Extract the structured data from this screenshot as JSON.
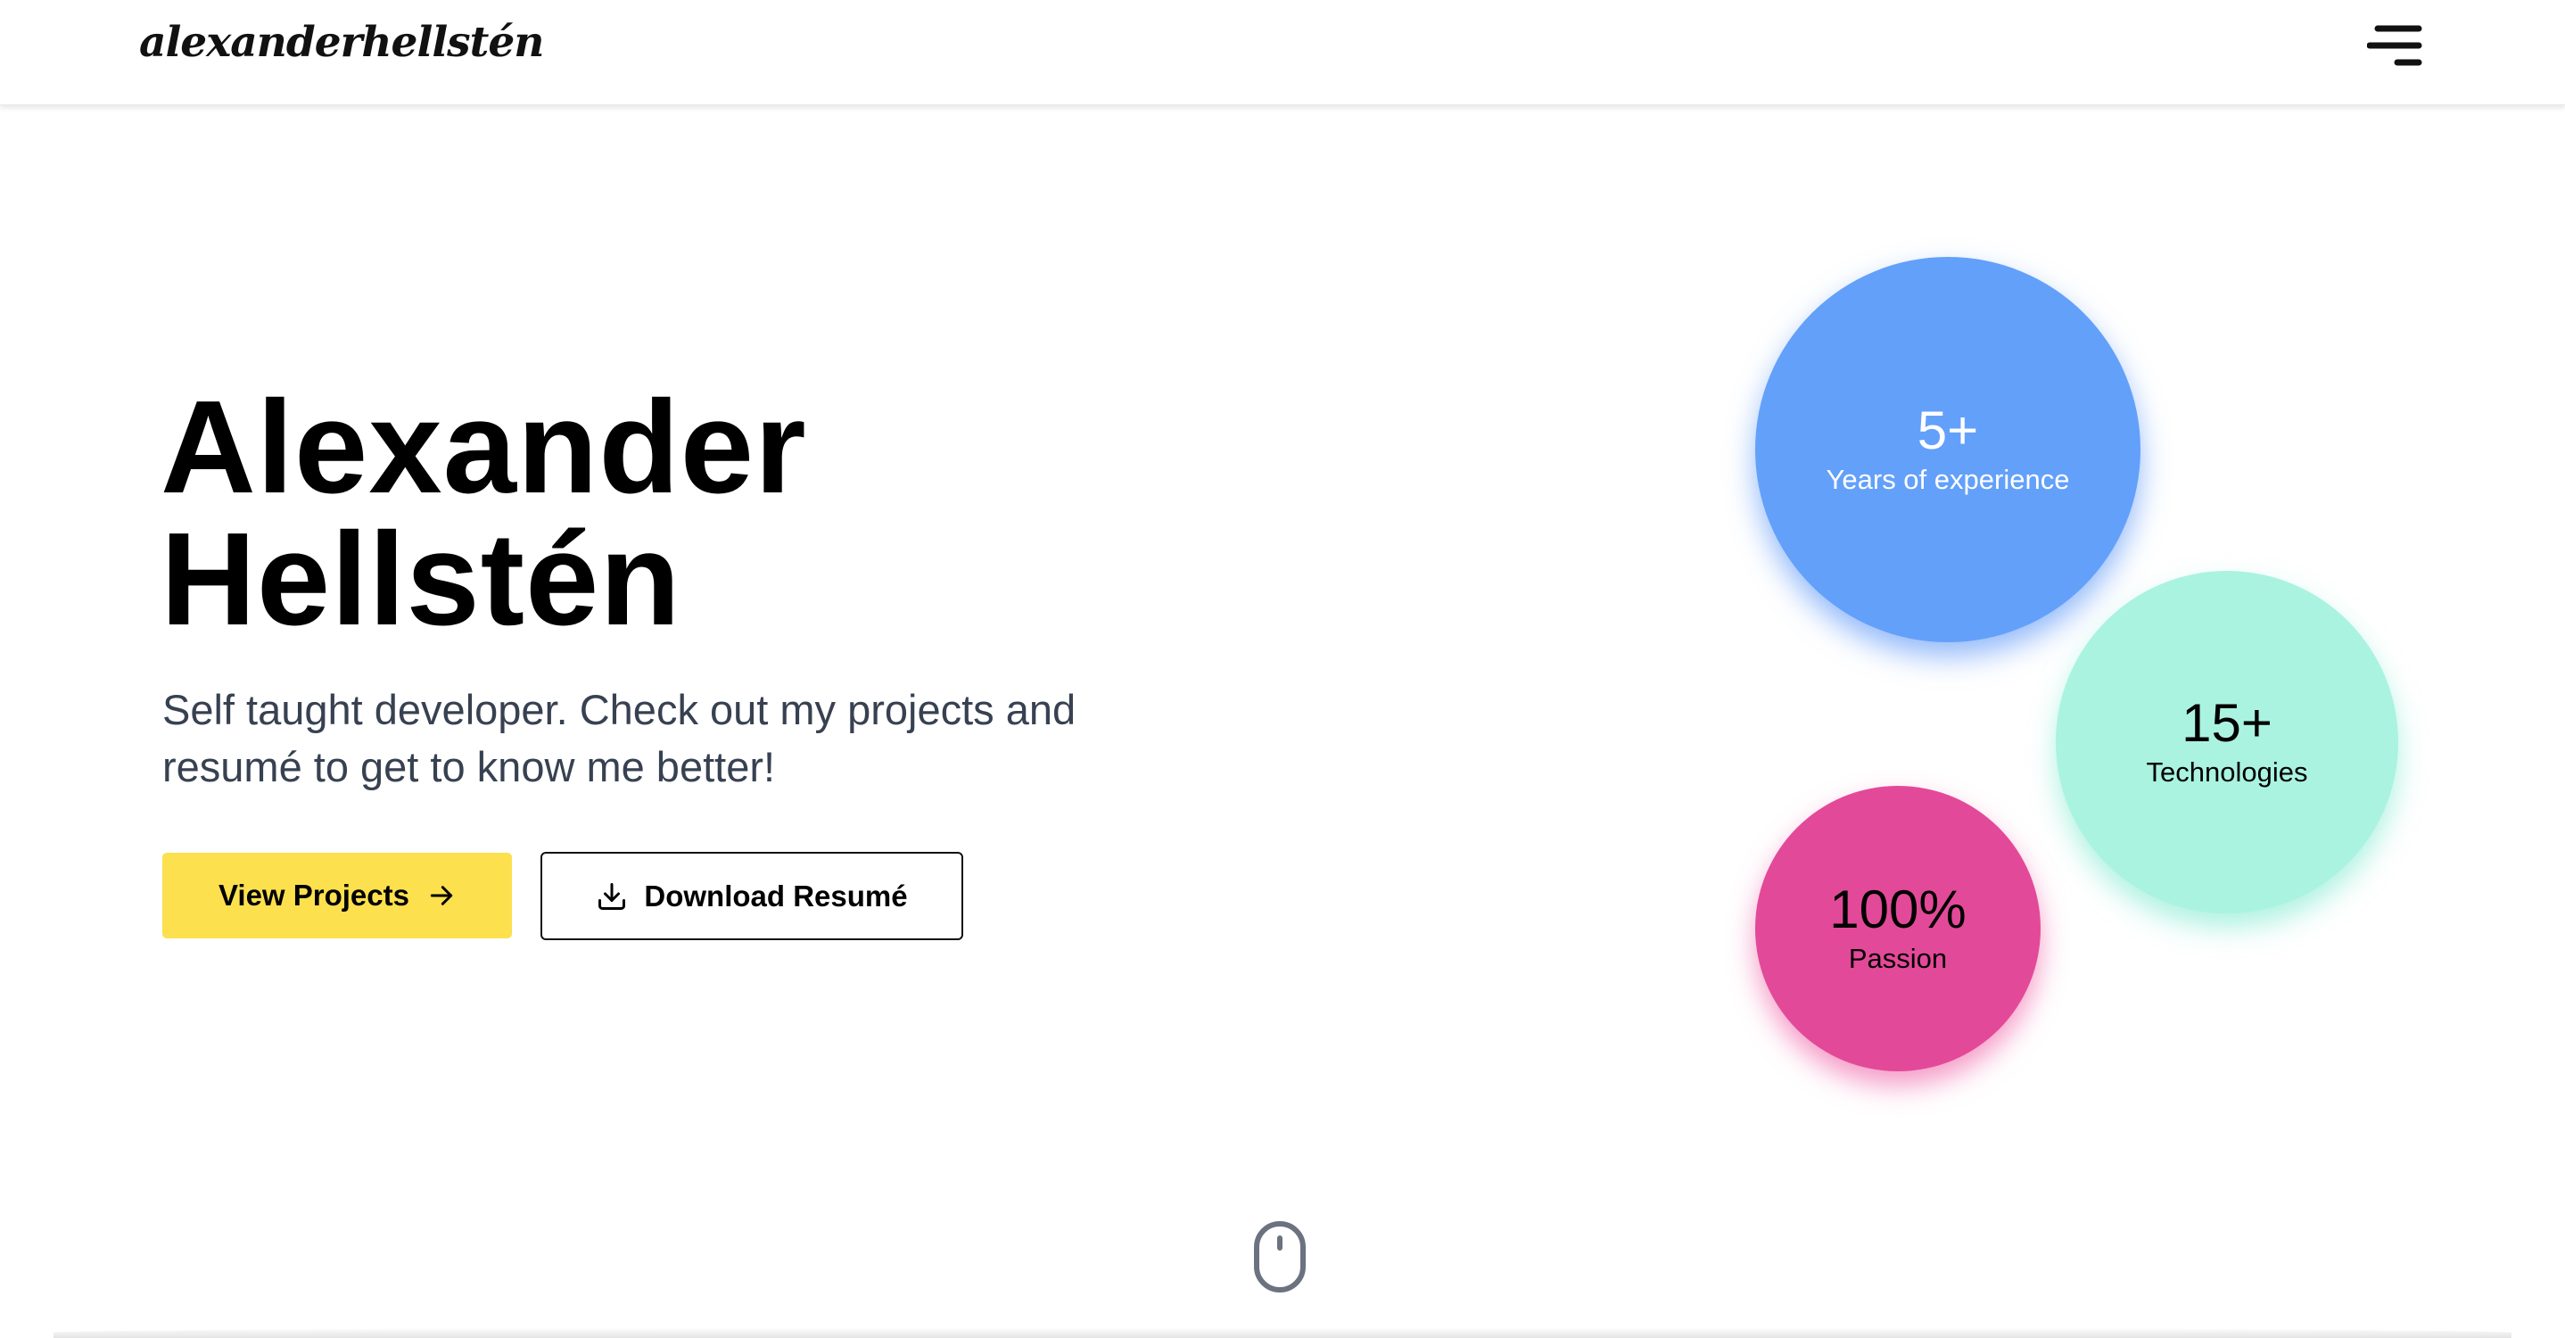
{
  "header": {
    "logo_text": "alexanderhellstén",
    "menu_icon": "hamburger-menu-icon"
  },
  "hero": {
    "title_line1": "Alexander",
    "title_line2": "Hellstén",
    "description": "Self taught developer. Check out my projects and resumé to get to know me better!",
    "buttons": {
      "view_projects": "View Projects",
      "view_projects_icon": "arrow-right-icon",
      "download_resume": "Download Resumé",
      "download_resume_icon": "download-icon"
    }
  },
  "stats": [
    {
      "value": "5+",
      "label": "Years of experience",
      "color": "#63a0fa"
    },
    {
      "value": "15+",
      "label": "Technologies",
      "color": "#aaf3e1"
    },
    {
      "value": "100%",
      "label": "Passion",
      "color": "#e34999"
    }
  ],
  "scroll_indicator": {
    "icon": "mouse-scroll-icon"
  },
  "colors": {
    "accent_yellow": "#fce04e",
    "text_dark": "#000000",
    "text_muted": "#374151"
  }
}
